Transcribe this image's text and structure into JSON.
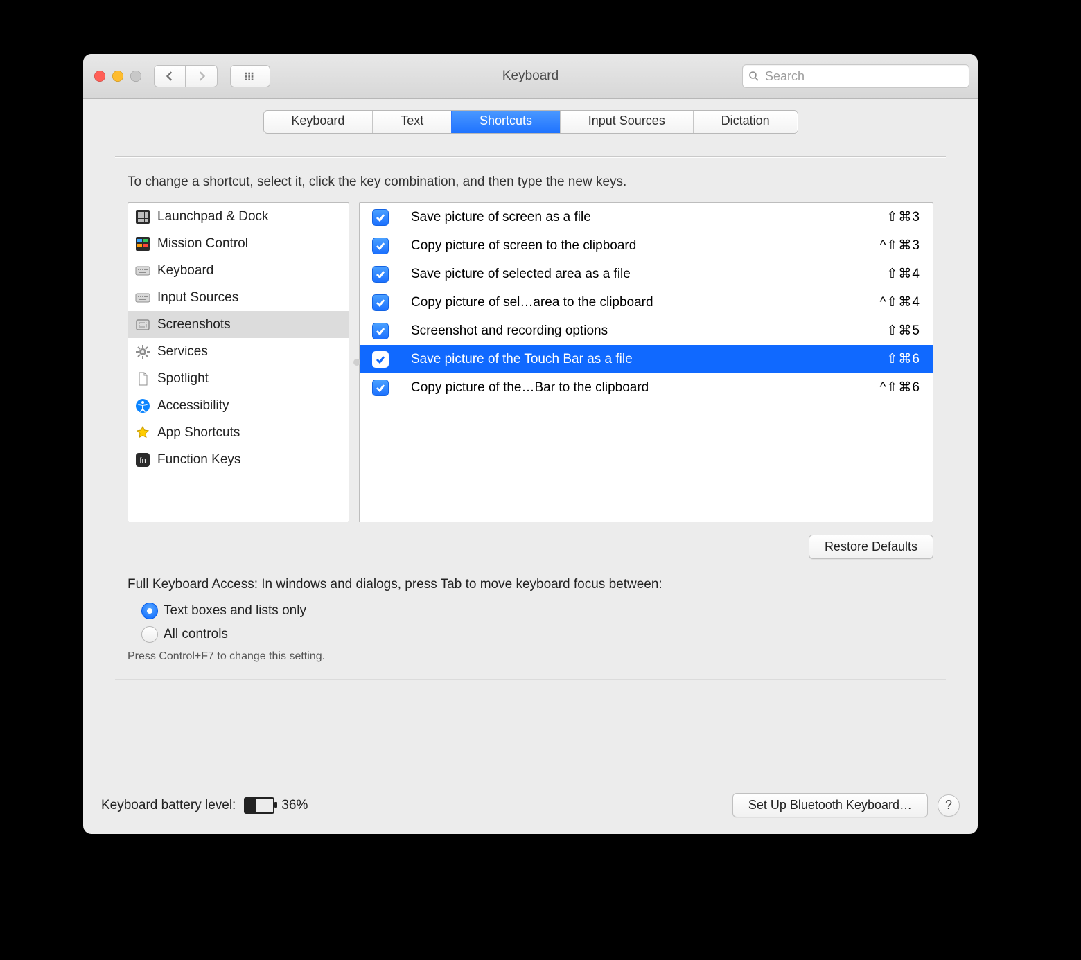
{
  "window": {
    "title": "Keyboard",
    "search_placeholder": "Search"
  },
  "tabs": [
    {
      "label": "Keyboard"
    },
    {
      "label": "Text"
    },
    {
      "label": "Shortcuts",
      "active": true
    },
    {
      "label": "Input Sources"
    },
    {
      "label": "Dictation"
    }
  ],
  "hint": "To change a shortcut, select it, click the key combination, and then type the new keys.",
  "categories": [
    {
      "label": "Launchpad & Dock",
      "icon": "launchpad-icon"
    },
    {
      "label": "Mission Control",
      "icon": "mission-control-icon"
    },
    {
      "label": "Keyboard",
      "icon": "keyboard-icon"
    },
    {
      "label": "Input Sources",
      "icon": "keyboard-icon"
    },
    {
      "label": "Screenshots",
      "icon": "screenshot-icon",
      "selected": true
    },
    {
      "label": "Services",
      "icon": "gear-icon"
    },
    {
      "label": "Spotlight",
      "icon": "document-icon"
    },
    {
      "label": "Accessibility",
      "icon": "accessibility-icon"
    },
    {
      "label": "App Shortcuts",
      "icon": "app-shortcut-icon"
    },
    {
      "label": "Function Keys",
      "icon": "fn-icon"
    }
  ],
  "shortcuts": [
    {
      "enabled": true,
      "label": "Save picture of screen as a file",
      "keys": "⇧⌘3"
    },
    {
      "enabled": true,
      "label": "Copy picture of screen to the clipboard",
      "keys": "^⇧⌘3"
    },
    {
      "enabled": true,
      "label": "Save picture of selected area as a file",
      "keys": "⇧⌘4"
    },
    {
      "enabled": true,
      "label": "Copy picture of sel…area to the clipboard",
      "keys": "^⇧⌘4"
    },
    {
      "enabled": true,
      "label": "Screenshot and recording options",
      "keys": "⇧⌘5"
    },
    {
      "enabled": true,
      "label": "Save picture of the Touch Bar as a file",
      "keys": "⇧⌘6",
      "selected": true
    },
    {
      "enabled": true,
      "label": "Copy picture of the…Bar to the clipboard",
      "keys": "^⇧⌘6"
    }
  ],
  "restore_label": "Restore Defaults",
  "fka": {
    "title": "Full Keyboard Access: In windows and dialogs, press Tab to move keyboard focus between:",
    "option1": "Text boxes and lists only",
    "option2": "All controls",
    "note": "Press Control+F7 to change this setting."
  },
  "footer": {
    "battery_label": "Keyboard battery level:",
    "battery_percent_num": 36,
    "battery_percent": "36%",
    "bluetooth_label": "Set Up Bluetooth Keyboard…",
    "help_label": "?"
  }
}
